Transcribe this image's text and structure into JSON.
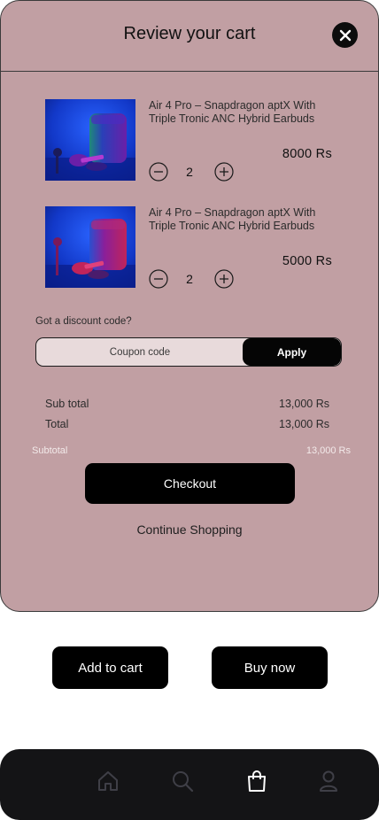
{
  "cart": {
    "title": "Review your cart",
    "items": [
      {
        "name": "Air 4 Pro  – Snapdragon aptX With Triple Tronic ANC Hybrid Earbuds",
        "price": "8000  Rs",
        "quantity": "2"
      },
      {
        "name": "Air 4 Pro  – Snapdragon aptX With Triple Tronic ANC Hybrid Earbuds",
        "price": "5000  Rs",
        "quantity": "2"
      }
    ],
    "discount": {
      "label": "Got a discount code?",
      "placeholder": "Coupon code",
      "apply_label": "Apply"
    },
    "summary": {
      "sub_total_label": "Sub total",
      "sub_total_value": "13,000 Rs",
      "total_label": "Total",
      "total_value": "13,000 Rs",
      "subtotal_label": "Subtotal",
      "subtotal_value": "13,000 Rs"
    },
    "checkout_label": "Checkout",
    "continue_label": "Continue Shopping"
  },
  "actions": {
    "add_to_cart": "Add to cart",
    "buy_now": "Buy now"
  },
  "nav": {
    "active": "cart",
    "items": [
      "home",
      "search",
      "cart",
      "profile"
    ]
  },
  "colors": {
    "sheet": "#c19fa3",
    "button": "#000000",
    "nav": "#141416",
    "coupon_field": "#e8dadb"
  },
  "icons": [
    "close-icon",
    "minus-icon",
    "plus-icon",
    "home-icon",
    "search-icon",
    "bag-icon",
    "user-icon"
  ]
}
